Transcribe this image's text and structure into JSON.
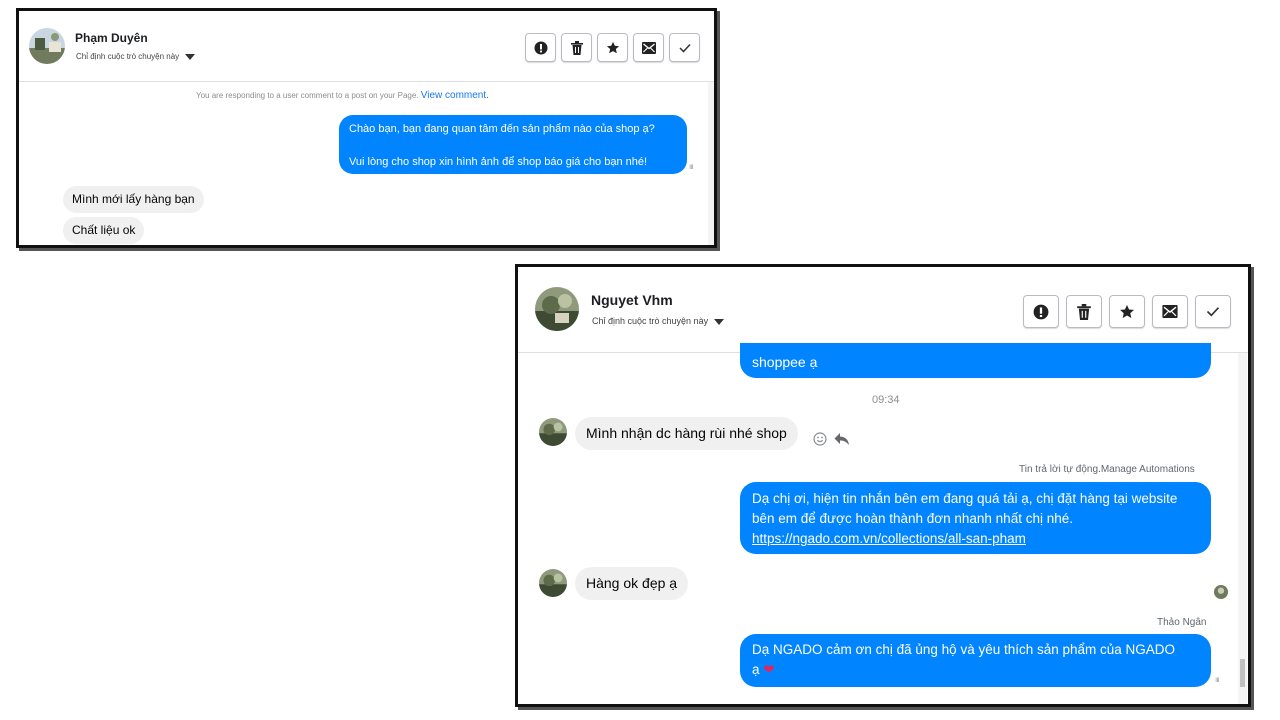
{
  "panel1": {
    "contact_name": "Phạm Duyên",
    "assign_label": "Chỉ định cuộc trò chuyện này",
    "notice_text": "You are responding to a user comment to a post on your Page.",
    "notice_link": "View comment.",
    "outgoing_lines": [
      "Chào bạn, bạn đang quan tâm đến sản phẩm nào của shop ạ?",
      "Vui lòng cho shop xin hình ảnh để shop báo giá cho bạn nhé!"
    ],
    "incoming": [
      "Mình mới lấy hàng bạn",
      "Chất liệu ok"
    ]
  },
  "panel2": {
    "contact_name": "Nguyet Vhm",
    "assign_label": "Chỉ định cuộc trò chuyện này",
    "partial_bubble": "shoppee ạ",
    "timestamp": "09:34",
    "incoming_1": "Mình nhận dc hàng rùi nhé shop",
    "auto_reply_label": "Tin trả lời tự động.",
    "manage_automations": "Manage Automations",
    "auto_reply_lines": [
      "Dạ chị ơi, hiện tin nhắn bên em đang quá tải ạ, chị đặt hàng tại website",
      "bên em để được hoàn thành đơn nhanh nhất chị nhé."
    ],
    "auto_reply_url": "https://ngado.com.vn/collections/all-san-pham",
    "incoming_2": "Hàng ok đẹp ạ",
    "agent_name": "Thảo Ngân",
    "final_lines": [
      "Dạ NGADO cảm ơn chị đã ủng hộ và yêu thích sản phẩm của NGADO",
      "ạ"
    ],
    "final_emoji": "❤"
  },
  "action_icons": [
    "alert-icon",
    "trash-icon",
    "star-icon",
    "envelope-icon",
    "check-icon"
  ],
  "colors": {
    "accent": "#0084ff",
    "incoming_bg": "#f0f0f0",
    "link": "#1877f2"
  }
}
